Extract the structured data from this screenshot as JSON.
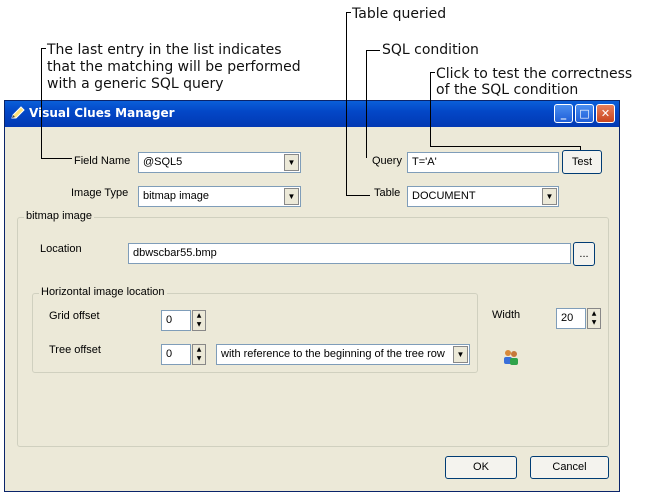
{
  "callouts": {
    "table_queried": "Table queried",
    "sql_condition": "SQL condition",
    "test_click_line1": "Click to test the correctness",
    "test_click_line2": "of the SQL condition",
    "last_entry_line1": "The last entry in the list indicates",
    "last_entry_line2": "that the matching will be performed",
    "last_entry_line3": "with a generic SQL query"
  },
  "window": {
    "title": "Visual Clues Manager",
    "minimize_label": "_",
    "maximize_label": "□",
    "close_label": "✕"
  },
  "form": {
    "field_name_label": "Field Name",
    "field_name_value": "@SQL5",
    "image_type_label": "Image Type",
    "image_type_value": "bitmap image",
    "query_label": "Query",
    "query_value": "T='A'",
    "test_button": "Test",
    "table_label": "Table",
    "table_value": "DOCUMENT"
  },
  "bitmap_group": {
    "title": "bitmap image",
    "location_label": "Location",
    "location_value": "dbwscbar55.bmp",
    "browse_button": "..."
  },
  "horizontal_group": {
    "title": "Horizontal image location",
    "grid_offset_label": "Grid offset",
    "grid_offset_value": "0",
    "tree_offset_label": "Tree offset",
    "tree_offset_value": "0",
    "reference_value": "with reference to the beginning of the tree row"
  },
  "width": {
    "label": "Width",
    "value": "20"
  },
  "footer": {
    "ok_button": "OK",
    "cancel_button": "Cancel"
  },
  "icons": {
    "dropdown": "dropdown-arrow-icon",
    "spin": "spin-updown-icon",
    "app": "pencil-icon",
    "users": "users-icon"
  }
}
